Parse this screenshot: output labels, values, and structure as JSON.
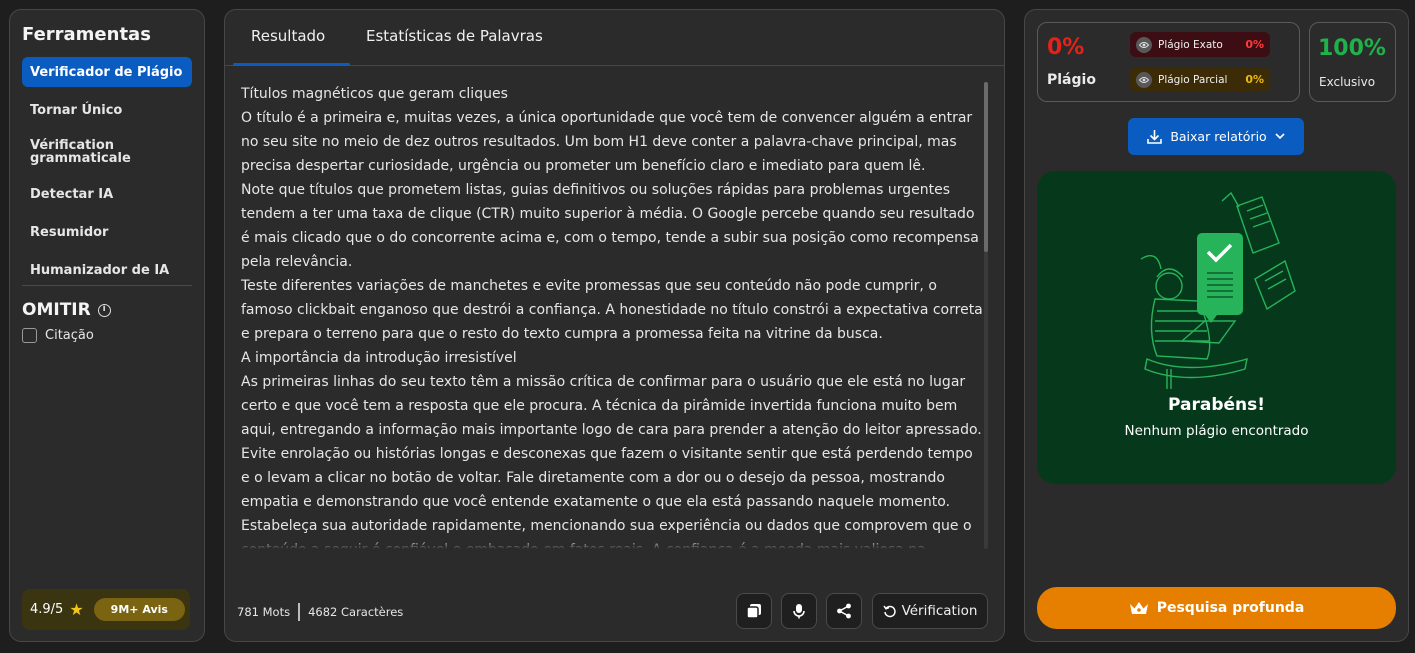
{
  "sidebar": {
    "title": "Ferramentas",
    "items": [
      {
        "label": "Verificador de Plágio"
      },
      {
        "label": "Tornar Único"
      },
      {
        "label": "Vérification grammaticale"
      },
      {
        "label": "Detectar IA"
      },
      {
        "label": "Resumidor"
      },
      {
        "label": "Humanizador de IA"
      }
    ],
    "omit_title": "OMITIR",
    "citation_label": "Citação",
    "rating_score": "4.9/5",
    "reviews_label": "9M+ Avis"
  },
  "tabs": [
    {
      "label": "Resultado"
    },
    {
      "label": "Estatísticas de Palavras"
    }
  ],
  "text": {
    "paragraphs": [
      "Títulos magnéticos que geram cliques",
      "O título é a primeira e, muitas vezes, a única oportunidade que você tem de convencer alguém a entrar no seu site no meio de dez outros resultados. Um bom H1 deve conter a palavra-chave principal, mas precisa despertar curiosidade, urgência ou prometer um benefício claro e imediato para quem lê.",
      "Note que títulos que prometem listas, guias definitivos ou soluções rápidas para problemas urgentes tendem a ter uma taxa de clique (CTR) muito superior à média. O Google percebe quando seu resultado é mais clicado que o do concorrente acima e, com o tempo, tende a subir sua posição como recompensa pela relevância.",
      "Teste diferentes variações de manchetes e evite promessas que seu conteúdo não pode cumprir, o famoso clickbait enganoso que destrói a confiança. A honestidade no título constrói a expectativa correta e prepara o terreno para que o resto do texto cumpra a promessa feita na vitrine da busca.",
      "A importância da introdução irresistível",
      "As primeiras linhas do seu texto têm a missão crítica de confirmar para o usuário que ele está no lugar certo e que você tem a resposta que ele procura. A técnica da pirâmide invertida funciona muito bem aqui, entregando a informação mais importante logo de cara para prender a atenção do leitor apressado.",
      "Evite enrolação ou histórias longas e desconexas que fazem o visitante sentir que está perdendo tempo e o levam a clicar no botão de voltar. Fale diretamente com a dor ou o desejo da pessoa, mostrando empatia e demonstrando que você entende exatamente o que ela está passando naquele momento.",
      "Estabeleça sua autoridade rapidamente, mencionando sua experiência ou dados que comprovem que o conteúdo a seguir é confiável e embasado em fatos reais. A confiança é a moeda mais valiosa na internet"
    ]
  },
  "footer": {
    "words": "781 Mots",
    "chars": "4682 Caractères",
    "verify_label": "Vérification"
  },
  "results": {
    "plagiarism_pct": "0%",
    "plagiarism_label": "Plágio",
    "exact_label": "Plágio Exato",
    "exact_pct": "0%",
    "partial_label": "Plágio Parcial",
    "partial_pct": "0%",
    "unique_pct": "100%",
    "unique_label": "Exclusivo",
    "download_label": "Baixar relatório",
    "congrats": "Parabéns!",
    "no_plag": "Nenhum plágio encontrado",
    "deep_search_label": "Pesquisa profunda"
  },
  "colors": {
    "accent_blue": "#0b5cc0",
    "plag_red": "#e2231a",
    "unique_green": "#1fb24a",
    "success_bg": "#06381c",
    "deep_orange": "#e67e00"
  }
}
